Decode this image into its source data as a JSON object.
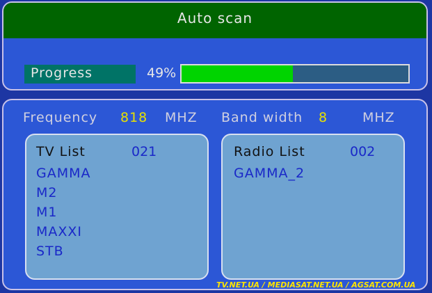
{
  "header": {
    "title": "Auto scan"
  },
  "progress": {
    "label": "Progress",
    "percent_text": "49%",
    "value": 0.49
  },
  "frequency": {
    "label": "Frequency",
    "value": "818",
    "unit": "MHZ"
  },
  "bandwidth": {
    "label": "Band width",
    "value": "8",
    "unit": "MHZ"
  },
  "tv_list": {
    "header": "TV List",
    "count": "021",
    "items": [
      "GAMMA",
      "M2",
      "M1",
      "MAXXI",
      "STB"
    ]
  },
  "radio_list": {
    "header": "Radio List",
    "count": "002",
    "items": [
      "GAMMA_2"
    ]
  },
  "watermark": "TV.NET.UA / MEDIASAT.NET.UA / AGSAT.COM.UA",
  "colors": {
    "title_bar": "#006400",
    "progress_fill": "#00d400",
    "value_highlight": "#e8e000",
    "list_item": "#1a28c8"
  }
}
